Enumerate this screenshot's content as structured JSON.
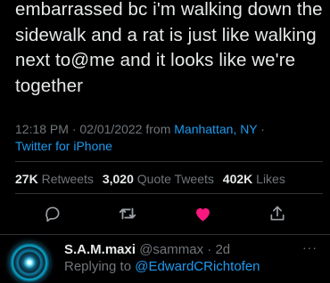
{
  "tweet": {
    "text": "embarrassed bc i'm walking down the sidewalk and a rat is just like walking next to@me and it looks like we're together",
    "time": "12:18 PM",
    "date": "02/01/2022",
    "from_label": "from",
    "location": "Manhattan, NY",
    "source": "Twitter for iPhone"
  },
  "stats": {
    "retweets_count": "27K",
    "retweets_label": "Retweets",
    "quotes_count": "3,020",
    "quotes_label": "Quote Tweets",
    "likes_count": "402K",
    "likes_label": "Likes"
  },
  "actions": {
    "reply_icon": "comment-icon",
    "retweet_icon": "retweet-icon",
    "like_icon": "heart-icon",
    "share_icon": "share-icon",
    "like_color": "#f91880"
  },
  "reply": {
    "name": "S.A.M.maxi",
    "handle": "@sammax",
    "time": "2d",
    "replying_label": "Replying to",
    "replying_to": "@EdwardCRichtofen",
    "more": "···"
  },
  "colors": {
    "background": "#000000",
    "text": "#e7e9ea",
    "muted": "#71767b",
    "link": "#1d9bf0",
    "divider": "#2f3336"
  }
}
